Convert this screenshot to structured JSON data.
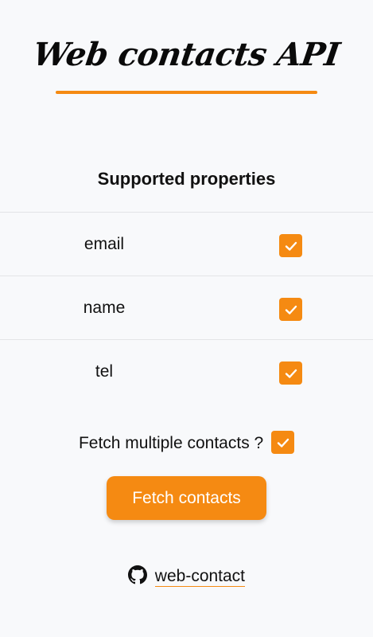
{
  "header": {
    "title": "Web contacts API"
  },
  "properties": {
    "heading": "Supported properties",
    "items": [
      {
        "label": "email",
        "checked": true
      },
      {
        "label": "name",
        "checked": true
      },
      {
        "label": "tel",
        "checked": true
      }
    ]
  },
  "options": {
    "multiple_label": "Fetch multiple contacts ?",
    "multiple_checked": true
  },
  "actions": {
    "fetch_label": "Fetch contacts"
  },
  "footer": {
    "icon": "github-icon",
    "link_text": "web-contact"
  },
  "colors": {
    "accent": "#f58a12",
    "background": "#f8f9fb",
    "divider": "#e3e4e7"
  }
}
